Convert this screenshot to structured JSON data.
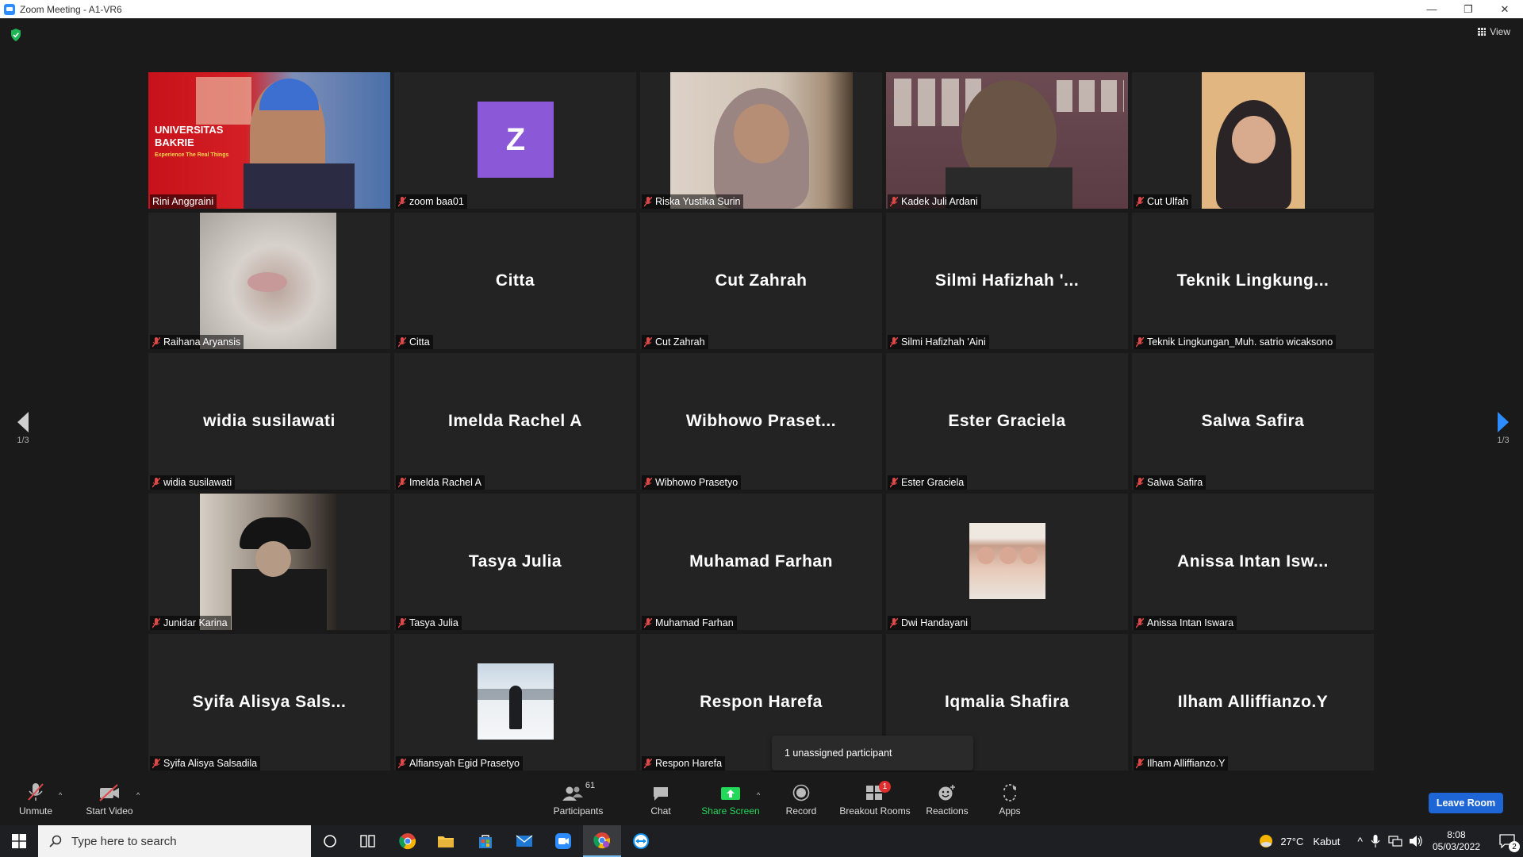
{
  "window": {
    "title": "Zoom Meeting - A1-VR6",
    "controls": [
      "—",
      "❐",
      "✕"
    ]
  },
  "header": {
    "view_label": "View"
  },
  "pager": {
    "left": "1/3",
    "right": "1/3"
  },
  "tiles": [
    {
      "display": "",
      "label": "Rini Anggraini",
      "kind": "video",
      "active": true,
      "muted": false
    },
    {
      "display": "",
      "label": "zoom baa01",
      "kind": "avatar",
      "avatar_letter": "Z",
      "muted": true
    },
    {
      "display": "",
      "label": "Riska Yustika Surin",
      "kind": "video",
      "muted": true
    },
    {
      "display": "",
      "label": "Kadek Juli Ardani",
      "kind": "video",
      "muted": true
    },
    {
      "display": "",
      "label": "Cut Ulfah",
      "kind": "video",
      "muted": true
    },
    {
      "display": "",
      "label": "Raihana Aryansis",
      "kind": "video",
      "muted": true
    },
    {
      "display": "Citta",
      "label": "Citta",
      "kind": "name",
      "muted": true
    },
    {
      "display": "Cut Zahrah",
      "label": "Cut Zahrah",
      "kind": "name",
      "muted": true
    },
    {
      "display": "Silmi Hafizhah '...",
      "label": "Silmi Hafizhah 'Aini",
      "kind": "name",
      "muted": true
    },
    {
      "display": "Teknik Lingkung...",
      "label": "Teknik Lingkungan_Muh. satrio wicaksono",
      "kind": "name",
      "muted": true
    },
    {
      "display": "widia susilawati",
      "label": "widia susilawati",
      "kind": "name",
      "muted": true
    },
    {
      "display": "Imelda Rachel A",
      "label": "Imelda Rachel A",
      "kind": "name",
      "muted": true
    },
    {
      "display": "Wibhowo Praset...",
      "label": "Wibhowo Prasetyo",
      "kind": "name",
      "muted": true
    },
    {
      "display": "Ester Graciela",
      "label": "Ester Graciela",
      "kind": "name",
      "muted": true
    },
    {
      "display": "Salwa Safira",
      "label": "Salwa Safira",
      "kind": "name",
      "muted": true
    },
    {
      "display": "",
      "label": "Junidar Karina",
      "kind": "video",
      "muted": true
    },
    {
      "display": "Tasya Julia",
      "label": "Tasya Julia",
      "kind": "name",
      "muted": true
    },
    {
      "display": "Muhamad Farhan",
      "label": "Muhamad Farhan",
      "kind": "name",
      "muted": true
    },
    {
      "display": "",
      "label": "Dwi Handayani",
      "kind": "photo",
      "muted": true
    },
    {
      "display": "Anissa Intan Isw...",
      "label": "Anissa Intan Iswara",
      "kind": "name",
      "muted": true
    },
    {
      "display": "Syifa Alisya Sals...",
      "label": "Syifa Alisya Salsadila",
      "kind": "name",
      "muted": true
    },
    {
      "display": "",
      "label": "Alfiansyah Egid Prasetyo",
      "kind": "photo",
      "muted": true
    },
    {
      "display": "Respon Harefa",
      "label": "Respon Harefa",
      "kind": "name",
      "muted": true
    },
    {
      "display": "Iqmalia Shafira",
      "label": "",
      "kind": "name",
      "muted": false
    },
    {
      "display": "Ilham Alliffianzo.Y",
      "label": "Ilham Alliffianzo.Y",
      "kind": "name",
      "muted": true
    }
  ],
  "rini_video_overlay": {
    "line1": "UNIVERSITAS",
    "line2": "BAKRIE",
    "line3": "Experience The Real Things"
  },
  "tooltip": "1 unassigned participant",
  "toolbar": {
    "unmute": "Unmute",
    "start_video": "Start Video",
    "participants": "Participants",
    "participants_count": "61",
    "chat": "Chat",
    "share_screen": "Share Screen",
    "record": "Record",
    "breakout_rooms": "Breakout Rooms",
    "breakout_badge": "1",
    "reactions": "Reactions",
    "apps": "Apps",
    "leave_room": "Leave Room"
  },
  "taskbar": {
    "search_placeholder": "Type here to search",
    "weather_temp": "27°C",
    "weather_desc": "Kabut",
    "time": "8:08",
    "date": "05/03/2022",
    "notification_count": "2"
  },
  "colors": {
    "active_speaker": "#f6ec4f",
    "share_green": "#23d959",
    "leave_blue": "#1e66d6",
    "avatar_purple": "#8b58d8",
    "muted_red": "#e04848"
  }
}
